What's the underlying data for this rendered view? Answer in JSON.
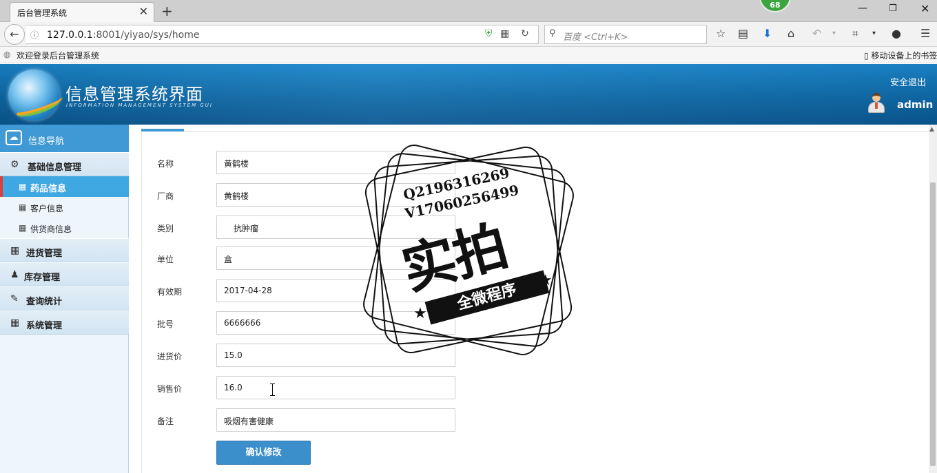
{
  "browser": {
    "tab_title": "后台管理系统",
    "badge_count": "68",
    "url_host": "127.0.0.1",
    "url_rest": ":8001/yiyao/sys/home",
    "search_placeholder": "百度 <Ctrl+K>",
    "bookmark_left": "欢迎登录后台管理系统",
    "bookmark_right": "移动设备上的书签"
  },
  "header": {
    "title": "信息管理系统界面",
    "subtitle": "INFORMATION MANAGEMENT SYSTEM GUI",
    "logout": "安全退出",
    "username": "admin"
  },
  "sidebar": {
    "nav_title": "信息导航",
    "groups": [
      {
        "label": "基础信息管理",
        "icon": "gears-icon"
      },
      {
        "label": "进货管理",
        "icon": "calendar-icon"
      },
      {
        "label": "库存管理",
        "icon": "users-icon"
      },
      {
        "label": "查询统计",
        "icon": "edit-icon"
      },
      {
        "label": "系统管理",
        "icon": "calendar-icon"
      }
    ],
    "items": [
      {
        "label": "药品信息",
        "active": true
      },
      {
        "label": "客户信息",
        "active": false
      },
      {
        "label": "供货商信息",
        "active": false
      }
    ]
  },
  "form": {
    "fields": [
      {
        "label": "名称",
        "value": "黄鹤楼"
      },
      {
        "label": "厂商",
        "value": "黄鹤楼"
      },
      {
        "label": "类别",
        "value": "抗肿瘤"
      },
      {
        "label": "单位",
        "value": "盒"
      },
      {
        "label": "有效期",
        "value": "2017-04-28"
      },
      {
        "label": "批号",
        "value": "6666666"
      },
      {
        "label": "进货价",
        "value": "15.0"
      },
      {
        "label": "销售价",
        "value": "16.0"
      },
      {
        "label": "备注",
        "value": "吸烟有害健康"
      }
    ],
    "submit": "确认修改"
  },
  "watermark": {
    "line1": "Q2196316269",
    "line2": "V17060256499",
    "big": "实拍",
    "ribbon": "全微程序"
  }
}
